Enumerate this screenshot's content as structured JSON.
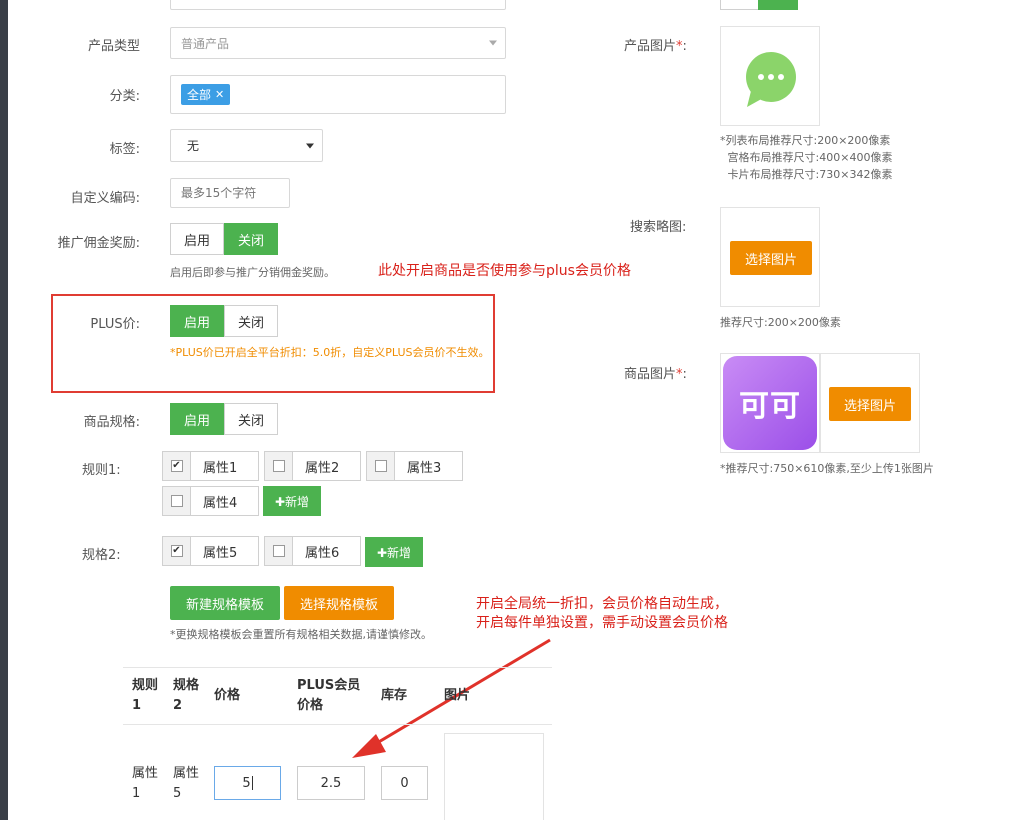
{
  "form": {
    "product_type": {
      "label": "产品类型",
      "value": "普通产品"
    },
    "category": {
      "label": "分类:",
      "tag": "全部",
      "tag_close": "✕"
    },
    "tags": {
      "label": "标签:",
      "value": "无"
    },
    "custom_code": {
      "label": "自定义编码:",
      "placeholder": "最多15个字符"
    },
    "commission": {
      "label": "推广佣金奖励:",
      "on": "启用",
      "off": "关闭",
      "hint": "启用后即参与推广分销佣金奖励。"
    },
    "plus_price": {
      "label": "PLUS价:",
      "on": "启用",
      "off": "关闭",
      "hint": "*PLUS价已开启全平台折扣：5.0折，自定义PLUS会员价不生效。"
    },
    "spec": {
      "label": "商品规格:",
      "on": "启用",
      "off": "关闭"
    },
    "rule1": {
      "label": "规则1:",
      "attrs": [
        {
          "name": "属性1",
          "checked": true
        },
        {
          "name": "属性2",
          "checked": false
        },
        {
          "name": "属性3",
          "checked": false
        },
        {
          "name": "属性4",
          "checked": false
        }
      ],
      "add": "✚新增"
    },
    "rule2": {
      "label": "规格2:",
      "attrs": [
        {
          "name": "属性5",
          "checked": true
        },
        {
          "name": "属性6",
          "checked": false
        }
      ],
      "add": "✚新增"
    },
    "template": {
      "new_btn": "新建规格模板",
      "select_btn": "选择规格模板",
      "hint": "*更换规格模板会重置所有规格相关数据,请谨慎修改。"
    }
  },
  "table": {
    "headers": [
      "规则1",
      "规格2",
      "价格",
      "PLUS会员价格",
      "库存",
      "图片"
    ],
    "row": {
      "rule1": "属性1",
      "rule2": "属性5",
      "price": "5",
      "plus_price": "2.5",
      "stock": "0"
    }
  },
  "right": {
    "product_image": {
      "label": "产品图片",
      "required": "*",
      "hints": [
        "*列表布局推荐尺寸:200×200像素",
        "宫格布局推荐尺寸:400×400像素",
        "卡片布局推荐尺寸:730×342像素"
      ]
    },
    "search_thumb": {
      "label": "搜索略图:",
      "button": "选择图片",
      "hint": "推荐尺寸:200×200像素"
    },
    "goods_image": {
      "label": "商品图片",
      "required": "*",
      "logo_text": "可可",
      "button": "选择图片",
      "hint": "*推荐尺寸:750×610像素,至少上传1张图片"
    }
  },
  "annotations": {
    "note1": "此处开启商品是否使用参与plus会员价格",
    "note2_line1": "开启全局统一折扣，会员价格自动生成，",
    "note2_line2": "开启每件单独设置，需手动设置会员价格"
  },
  "colors": {
    "green": "#4cb24f",
    "orange": "#f08c00",
    "blue_tag": "#3c9ee5",
    "red": "#d9211a"
  }
}
